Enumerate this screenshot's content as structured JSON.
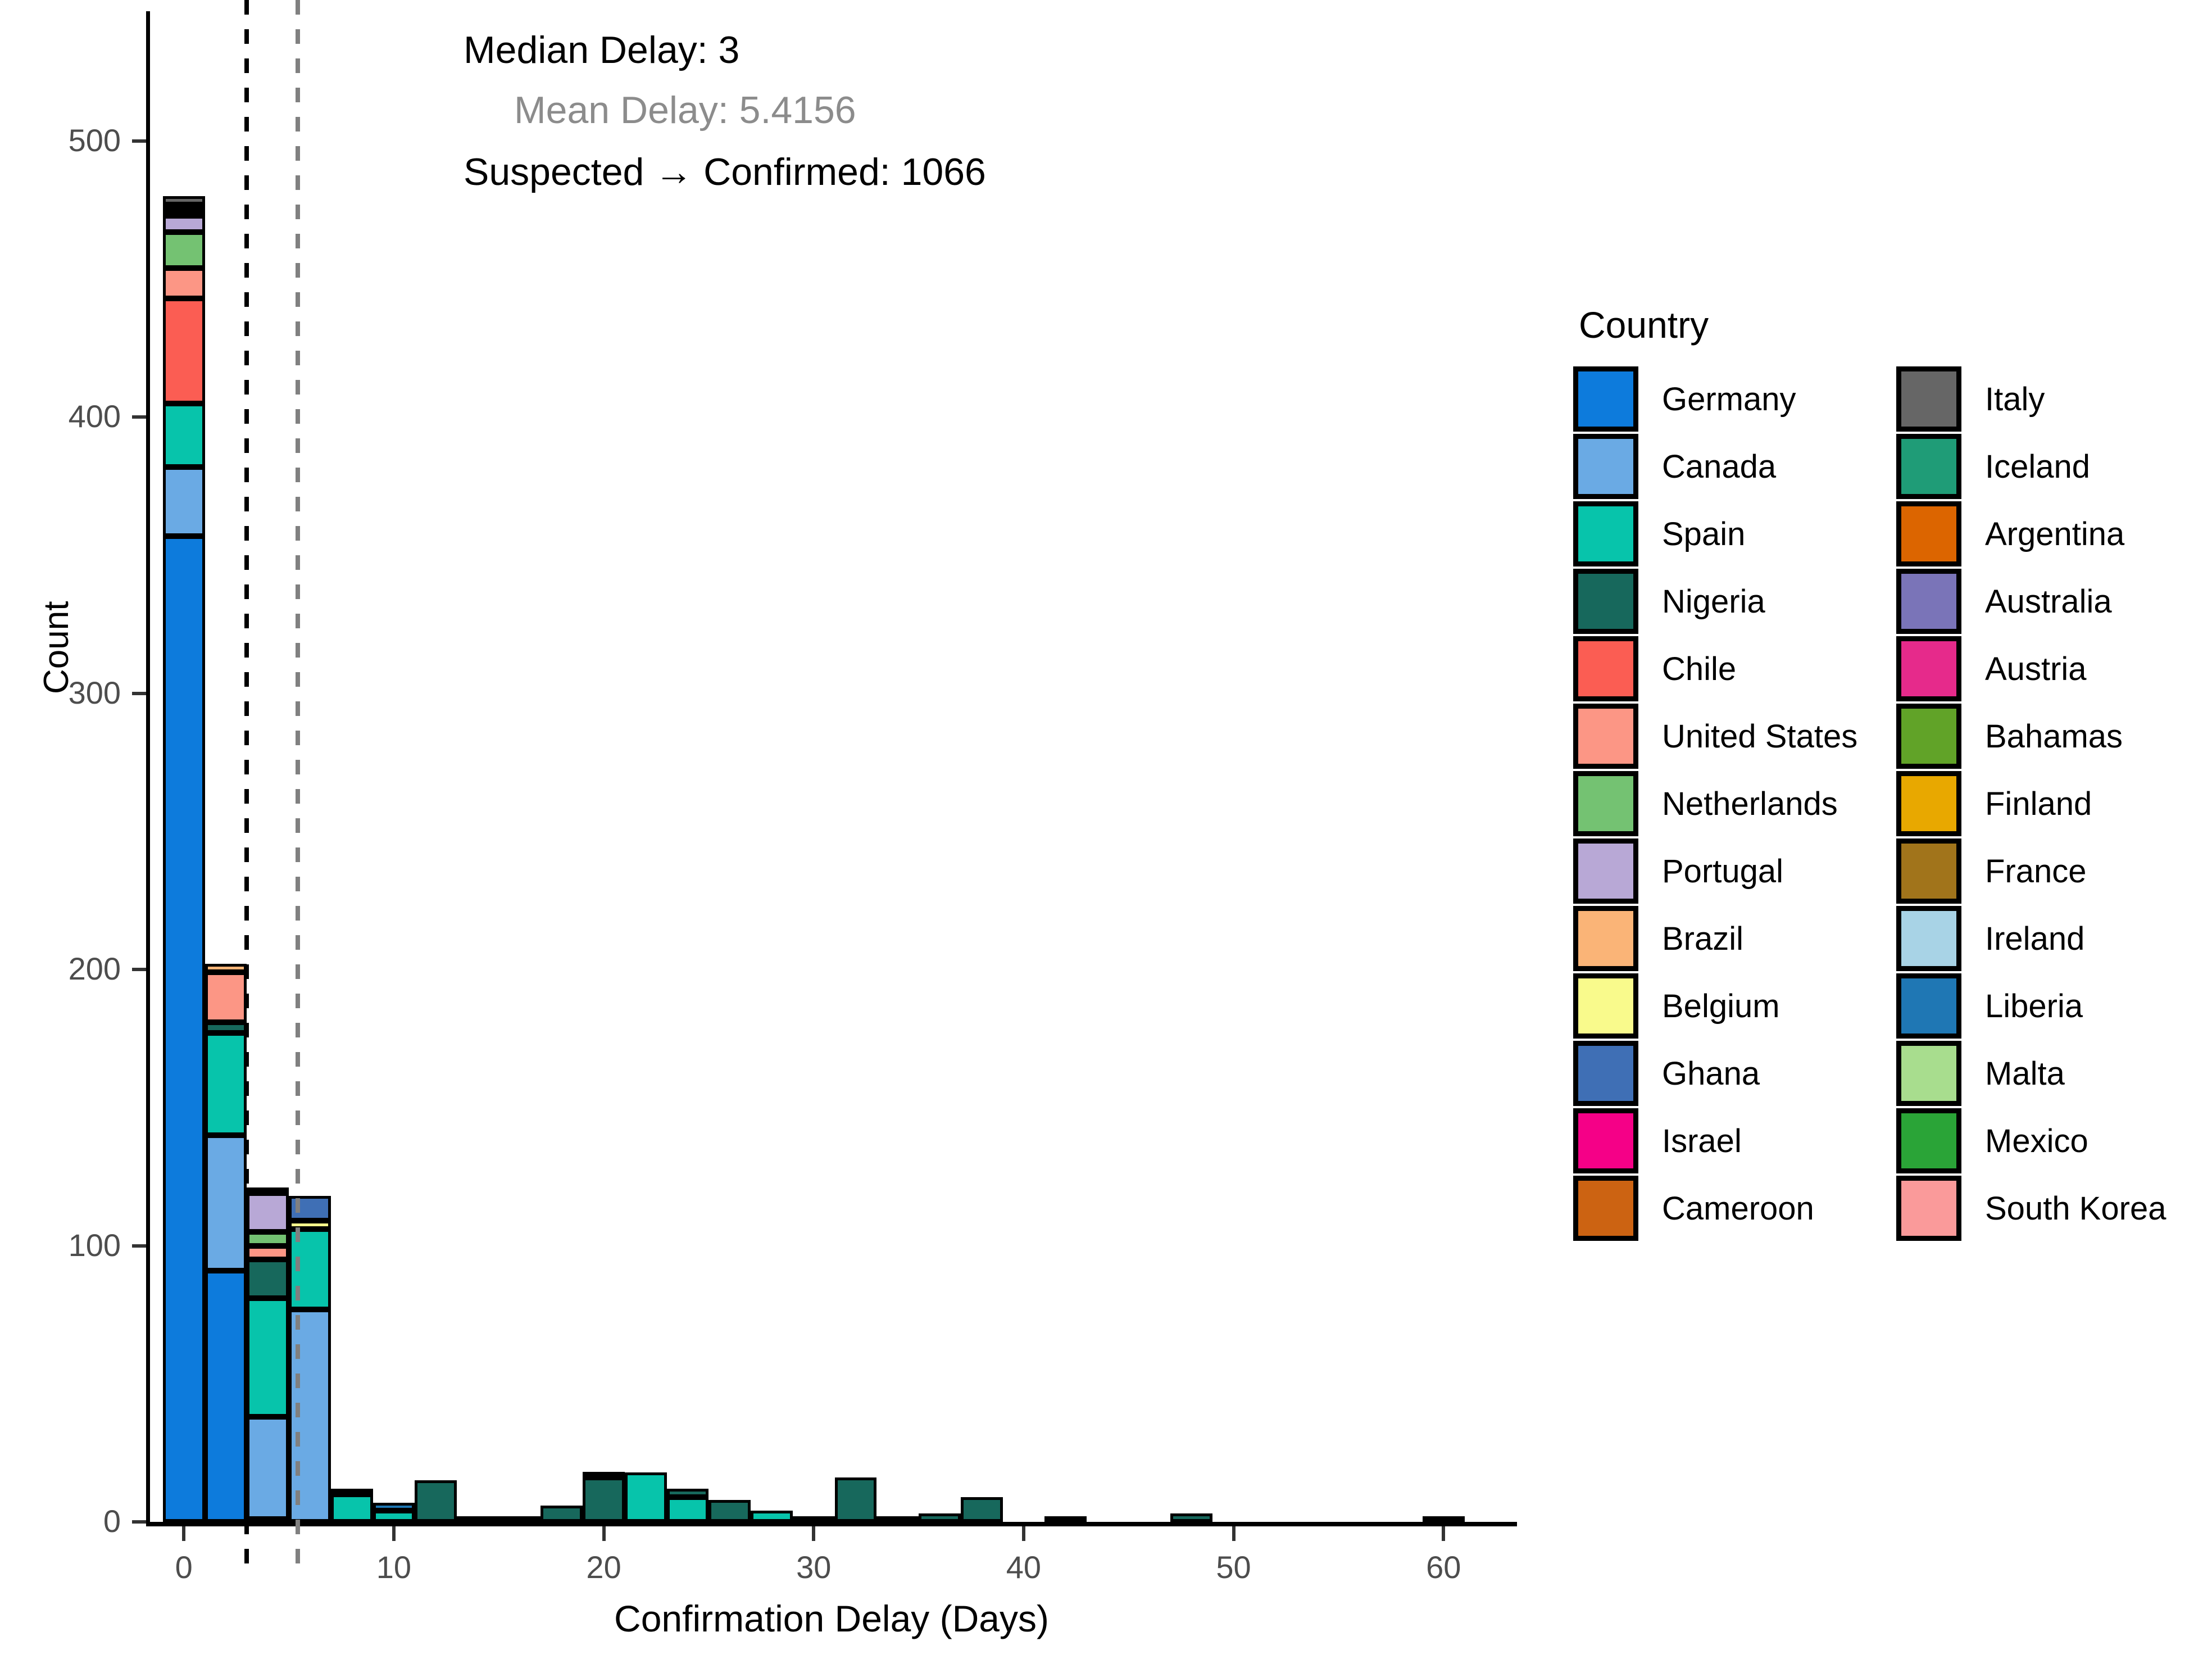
{
  "axes": {
    "x_title": "Confirmation Delay (Days)",
    "y_title": "Count",
    "x_ticks": [
      "0",
      "10",
      "20",
      "30",
      "40",
      "50",
      "60"
    ],
    "y_ticks": [
      "0",
      "100",
      "200",
      "300",
      "400",
      "500"
    ]
  },
  "annotations": {
    "median": "Median Delay: 3",
    "mean": "Mean Delay: 5.4156",
    "conversion": "Suspected → Confirmed: 1066",
    "median_color": "#000000",
    "mean_color": "#8c8c8c"
  },
  "legend": {
    "title": "Country",
    "column_a": [
      {
        "label": "Germany",
        "color": "#0d7bdc"
      },
      {
        "label": "Canada",
        "color": "#6aaae4"
      },
      {
        "label": "Spain",
        "color": "#07c4ab"
      },
      {
        "label": "Nigeria",
        "color": "#17685c"
      },
      {
        "label": "Chile",
        "color": "#fb5d53"
      },
      {
        "label": "United States",
        "color": "#fc9685"
      },
      {
        "label": "Netherlands",
        "color": "#74c272"
      },
      {
        "label": "Portugal",
        "color": "#b8a8d6"
      },
      {
        "label": "Brazil",
        "color": "#fab477"
      },
      {
        "label": "Belgium",
        "color": "#f9fa8c"
      },
      {
        "label": "Ghana",
        "color": "#3f6fb5"
      },
      {
        "label": "Israel",
        "color": "#f50087"
      },
      {
        "label": "Cameroon",
        "color": "#cc6312"
      }
    ],
    "column_b": [
      {
        "label": "Italy",
        "color": "#666666"
      },
      {
        "label": "Iceland",
        "color": "#1f9c77"
      },
      {
        "label": "Argentina",
        "color": "#dc6500"
      },
      {
        "label": "Australia",
        "color": "#7a74b8"
      },
      {
        "label": "Austria",
        "color": "#e62a8b"
      },
      {
        "label": "Bahamas",
        "color": "#61a328"
      },
      {
        "label": "Finland",
        "color": "#e8a800"
      },
      {
        "label": "France",
        "color": "#a1741b"
      },
      {
        "label": "Ireland",
        "color": "#a8d3e6"
      },
      {
        "label": "Liberia",
        "color": "#1f77b4"
      },
      {
        "label": "Malta",
        "color": "#a8dd8e"
      },
      {
        "label": "Mexico",
        "color": "#2aa437"
      },
      {
        "label": "South Korea",
        "color": "#fa9a9a"
      }
    ]
  },
  "chart_data": {
    "type": "bar",
    "subtype": "stacked-histogram",
    "title": "",
    "xlabel": "Confirmation Delay (Days)",
    "ylabel": "Count",
    "xlim": [
      -1.8,
      63.5
    ],
    "ylim": [
      0,
      545
    ],
    "bin_width": 2,
    "grid": false,
    "legend_position": "right",
    "median_delay": 3,
    "mean_delay": 5.4156,
    "suspected_to_confirmed": 1066,
    "totals_by_bin": [
      {
        "x": 0,
        "total": 480
      },
      {
        "x": 2,
        "total": 202
      },
      {
        "x": 4,
        "total": 121
      },
      {
        "x": 6,
        "total": 118
      },
      {
        "x": 8,
        "total": 12
      },
      {
        "x": 10,
        "total": 7
      },
      {
        "x": 12,
        "total": 15
      },
      {
        "x": 14,
        "total": 2
      },
      {
        "x": 16,
        "total": 1
      },
      {
        "x": 18,
        "total": 6
      },
      {
        "x": 20,
        "total": 18
      },
      {
        "x": 22,
        "total": 18
      },
      {
        "x": 24,
        "total": 12
      },
      {
        "x": 26,
        "total": 8
      },
      {
        "x": 28,
        "total": 4
      },
      {
        "x": 30,
        "total": 1
      },
      {
        "x": 32,
        "total": 16
      },
      {
        "x": 34,
        "total": 1
      },
      {
        "x": 36,
        "total": 3
      },
      {
        "x": 38,
        "total": 9
      },
      {
        "x": 42,
        "total": 2
      },
      {
        "x": 48,
        "total": 3
      },
      {
        "x": 60,
        "total": 1
      }
    ],
    "stacks": [
      {
        "x": 0,
        "total": 480,
        "segments": [
          {
            "country": "Germany",
            "value": 357,
            "color": "#0d7bdc"
          },
          {
            "country": "Canada",
            "value": 25,
            "color": "#6aaae4"
          },
          {
            "country": "Spain",
            "value": 23,
            "color": "#07c4ab"
          },
          {
            "country": "Chile",
            "value": 38,
            "color": "#fb5d53"
          },
          {
            "country": "United States",
            "value": 11,
            "color": "#fc9685"
          },
          {
            "country": "Netherlands",
            "value": 13,
            "color": "#74c272"
          },
          {
            "country": "Portugal",
            "value": 6,
            "color": "#b8a8d6"
          },
          {
            "country": "Belgium",
            "value": 2,
            "color": "#f9fa8c"
          },
          {
            "country": "Israel",
            "value": 2,
            "color": "#f50087"
          },
          {
            "country": "Italy",
            "value": 3,
            "color": "#666666"
          }
        ]
      },
      {
        "x": 2,
        "total": 202,
        "segments": [
          {
            "country": "Germany",
            "value": 91,
            "color": "#0d7bdc"
          },
          {
            "country": "Canada",
            "value": 49,
            "color": "#6aaae4"
          },
          {
            "country": "Spain",
            "value": 37,
            "color": "#07c4ab"
          },
          {
            "country": "Nigeria",
            "value": 4,
            "color": "#17685c"
          },
          {
            "country": "United States",
            "value": 18,
            "color": "#fc9685"
          },
          {
            "country": "Brazil",
            "value": 3,
            "color": "#fab477"
          }
        ]
      },
      {
        "x": 4,
        "total": 121,
        "segments": [
          {
            "country": "Germany",
            "value": 1,
            "color": "#0d7bdc"
          },
          {
            "country": "Canada",
            "value": 37,
            "color": "#6aaae4"
          },
          {
            "country": "Spain",
            "value": 43,
            "color": "#07c4ab"
          },
          {
            "country": "Nigeria",
            "value": 14,
            "color": "#17685c"
          },
          {
            "country": "United States",
            "value": 5,
            "color": "#fc9685"
          },
          {
            "country": "Netherlands",
            "value": 5,
            "color": "#74c272"
          },
          {
            "country": "Portugal",
            "value": 14,
            "color": "#b8a8d6"
          },
          {
            "country": "Mexico",
            "value": 2,
            "color": "#2aa437"
          }
        ]
      },
      {
        "x": 6,
        "total": 118,
        "segments": [
          {
            "country": "Canada",
            "value": 77,
            "color": "#6aaae4"
          },
          {
            "country": "Spain",
            "value": 29,
            "color": "#07c4ab"
          },
          {
            "country": "Belgium",
            "value": 3,
            "color": "#f9fa8c"
          },
          {
            "country": "Ghana",
            "value": 9,
            "color": "#3f6fb5"
          }
        ]
      },
      {
        "x": 8,
        "total": 12,
        "segments": [
          {
            "country": "Spain",
            "value": 10,
            "color": "#07c4ab"
          },
          {
            "country": "Brazil",
            "value": 2,
            "color": "#fab477"
          }
        ]
      },
      {
        "x": 10,
        "total": 7,
        "segments": [
          {
            "country": "Spain",
            "value": 4,
            "color": "#07c4ab"
          },
          {
            "country": "Liberia",
            "value": 3,
            "color": "#1f77b4"
          }
        ]
      },
      {
        "x": 12,
        "total": 15,
        "segments": [
          {
            "country": "Nigeria",
            "value": 15,
            "color": "#17685c"
          }
        ]
      },
      {
        "x": 14,
        "total": 2,
        "segments": [
          {
            "country": "Spain",
            "value": 2,
            "color": "#07c4ab"
          }
        ]
      },
      {
        "x": 16,
        "total": 1,
        "segments": [
          {
            "country": "Nigeria",
            "value": 1,
            "color": "#17685c"
          }
        ]
      },
      {
        "x": 18,
        "total": 6,
        "segments": [
          {
            "country": "Nigeria",
            "value": 6,
            "color": "#17685c"
          }
        ]
      },
      {
        "x": 20,
        "total": 18,
        "segments": [
          {
            "country": "Nigeria",
            "value": 16,
            "color": "#17685c"
          },
          {
            "country": "Argentina",
            "value": 2,
            "color": "#dc6500"
          }
        ]
      },
      {
        "x": 22,
        "total": 18,
        "segments": [
          {
            "country": "Spain",
            "value": 18,
            "color": "#07c4ab"
          }
        ]
      },
      {
        "x": 24,
        "total": 12,
        "segments": [
          {
            "country": "Spain",
            "value": 9,
            "color": "#07c4ab"
          },
          {
            "country": "Nigeria",
            "value": 3,
            "color": "#17685c"
          }
        ]
      },
      {
        "x": 26,
        "total": 8,
        "segments": [
          {
            "country": "Nigeria",
            "value": 8,
            "color": "#17685c"
          }
        ]
      },
      {
        "x": 28,
        "total": 4,
        "segments": [
          {
            "country": "Spain",
            "value": 4,
            "color": "#07c4ab"
          }
        ]
      },
      {
        "x": 30,
        "total": 1,
        "segments": [
          {
            "country": "Nigeria",
            "value": 1,
            "color": "#17685c"
          }
        ]
      },
      {
        "x": 32,
        "total": 16,
        "segments": [
          {
            "country": "Nigeria",
            "value": 16,
            "color": "#17685c"
          }
        ]
      },
      {
        "x": 34,
        "total": 1,
        "segments": [
          {
            "country": "Nigeria",
            "value": 1,
            "color": "#17685c"
          }
        ]
      },
      {
        "x": 36,
        "total": 3,
        "segments": [
          {
            "country": "Nigeria",
            "value": 3,
            "color": "#17685c"
          }
        ]
      },
      {
        "x": 38,
        "total": 9,
        "segments": [
          {
            "country": "Nigeria",
            "value": 9,
            "color": "#17685c"
          }
        ]
      },
      {
        "x": 42,
        "total": 2,
        "segments": [
          {
            "country": "Nigeria",
            "value": 2,
            "color": "#17685c"
          }
        ]
      },
      {
        "x": 48,
        "total": 3,
        "segments": [
          {
            "country": "Nigeria",
            "value": 3,
            "color": "#17685c"
          }
        ]
      },
      {
        "x": 60,
        "total": 1,
        "segments": [
          {
            "country": "Nigeria",
            "value": 1,
            "color": "#17685c"
          }
        ]
      }
    ],
    "reference_lines": [
      {
        "name": "median",
        "x": 3,
        "color": "#000000",
        "style": "dashed"
      },
      {
        "name": "mean",
        "x": 5.4156,
        "color": "#808080",
        "style": "dashed"
      }
    ]
  }
}
